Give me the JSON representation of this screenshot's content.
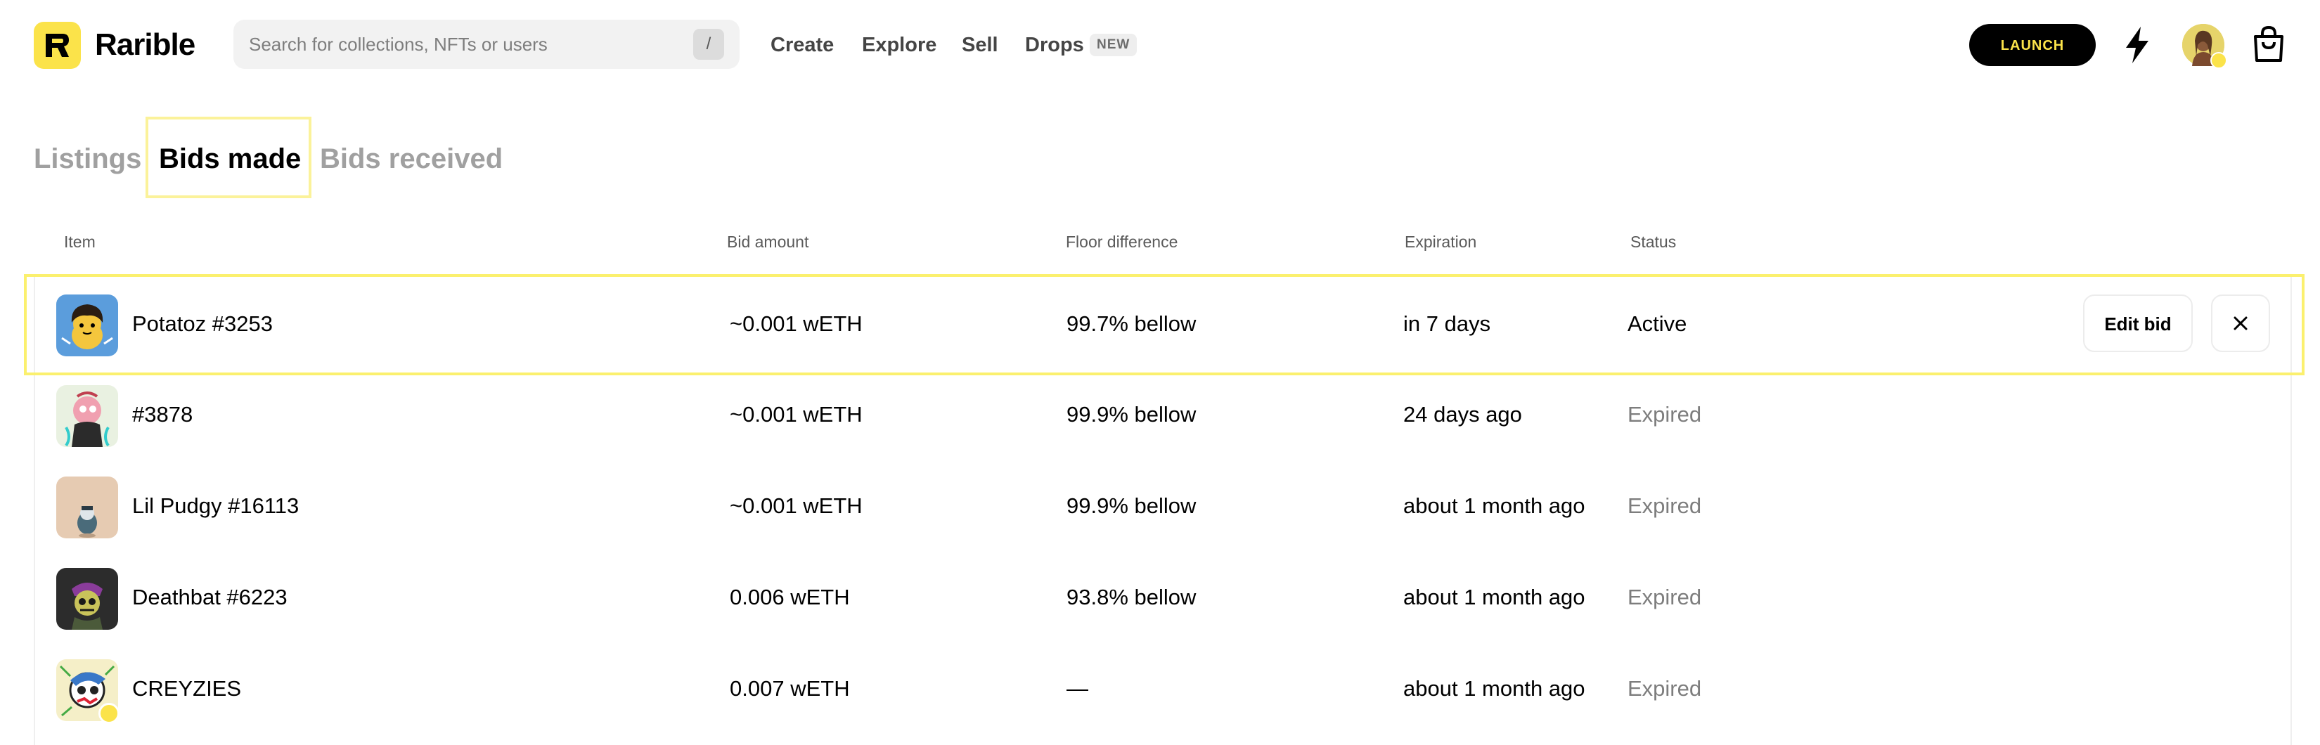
{
  "header": {
    "brand": "Rarible",
    "search_placeholder": "Search for collections, NFTs or users",
    "search_shortcut": "/",
    "nav": [
      {
        "label": "Create"
      },
      {
        "label": "Explore"
      },
      {
        "label": "Sell"
      },
      {
        "label": "Drops"
      }
    ],
    "drops_badge": "NEW",
    "launch_label": "LAUNCH",
    "icons": {
      "bolt": "lightning-bolt-icon",
      "cart": "shopping-bag-icon",
      "avatar": "user-avatar"
    }
  },
  "tabs": [
    {
      "label": "Listings",
      "active": false
    },
    {
      "label": "Bids made",
      "active": true
    },
    {
      "label": "Bids received",
      "active": false
    }
  ],
  "table": {
    "columns": [
      "Item",
      "Bid amount",
      "Floor difference",
      "Expiration",
      "Status"
    ],
    "rows": [
      {
        "item": "Potatoz #3253",
        "bid": "~0.001 wETH",
        "floor": "99.7% bellow",
        "expiration": "in 7 days",
        "status": "Active",
        "actions": {
          "edit": "Edit bid",
          "close": "close-icon"
        }
      },
      {
        "item": "#3878",
        "bid": "~0.001 wETH",
        "floor": "99.9% bellow",
        "expiration": "24 days ago",
        "status": "Expired"
      },
      {
        "item": "Lil Pudgy #16113",
        "bid": "~0.001 wETH",
        "floor": "99.9% bellow",
        "expiration": "about 1 month ago",
        "status": "Expired"
      },
      {
        "item": "Deathbat #6223",
        "bid": "0.006 wETH",
        "floor": "93.8% bellow",
        "expiration": "about 1 month ago",
        "status": "Expired"
      },
      {
        "item": "CREYZIES",
        "bid": "0.007 wETH",
        "floor": "—",
        "expiration": "about 1 month ago",
        "status": "Expired"
      }
    ]
  },
  "colors": {
    "brand_yellow": "#fbe34a",
    "highlight": "#fbf06e",
    "muted": "#7d7d7d"
  }
}
